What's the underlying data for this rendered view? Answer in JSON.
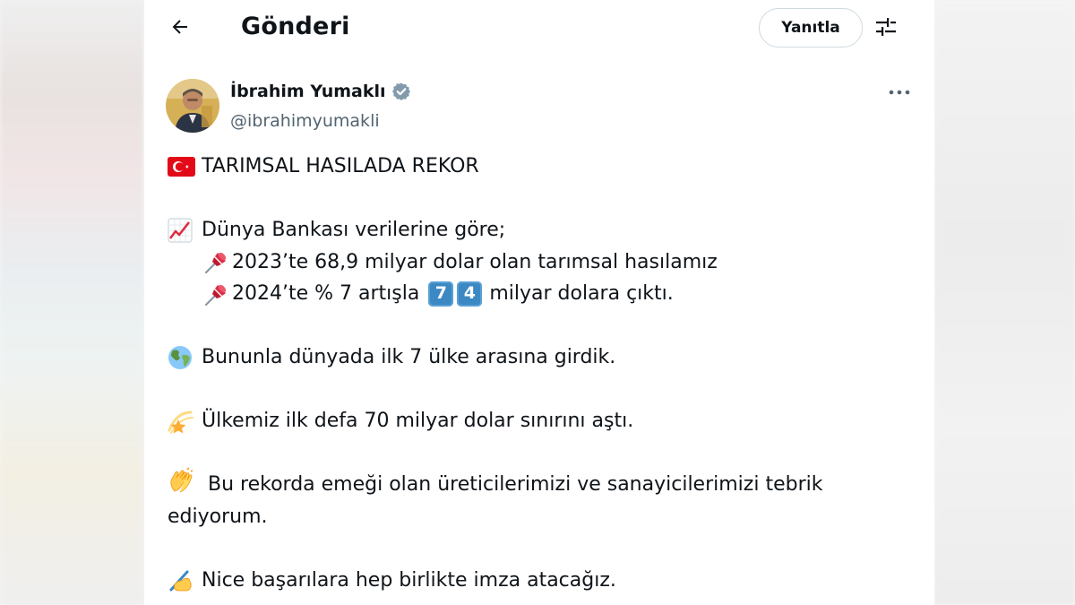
{
  "header": {
    "title": "Gönderi",
    "reply_label": "Yanıtla"
  },
  "author": {
    "name": "İbrahim Yumaklı",
    "handle": "@ibrahimyumakli"
  },
  "tweet": {
    "line1": "TARIMSAL HASILADA REKOR",
    "line2": "Dünya Bankası verilerine göre;",
    "line3": "2023’te 68,9 milyar dolar olan tarımsal hasılamız",
    "line4_a": "2024’te % 7 artışla",
    "key1": "7",
    "key2": "4",
    "line4_b": "milyar dolara çıktı.",
    "line5": "Bununla dünyada ilk 7 ülke arasına girdik.",
    "line6": "Ülkemiz ilk defa 70 milyar dolar sınırını aştı.",
    "line7": "Bu rekorda emeği olan üreticilerimizi ve sanayicilerimizi tebrik ediyorum.",
    "line8": "Nice başarılara hep birlikte imza atacağız."
  },
  "colors": {
    "text": "#0f1419",
    "secondary": "#536471",
    "verified": "#829aab",
    "keycap": "#3b88c3"
  },
  "icons": [
    "back-arrow-icon",
    "filter-icon",
    "verified-badge-icon",
    "more-icon",
    "turkey-flag-icon",
    "chart-increasing-icon",
    "pushpin-icon",
    "globe-icon",
    "dizzy-star-icon",
    "clapping-hands-icon",
    "writing-hand-icon"
  ]
}
